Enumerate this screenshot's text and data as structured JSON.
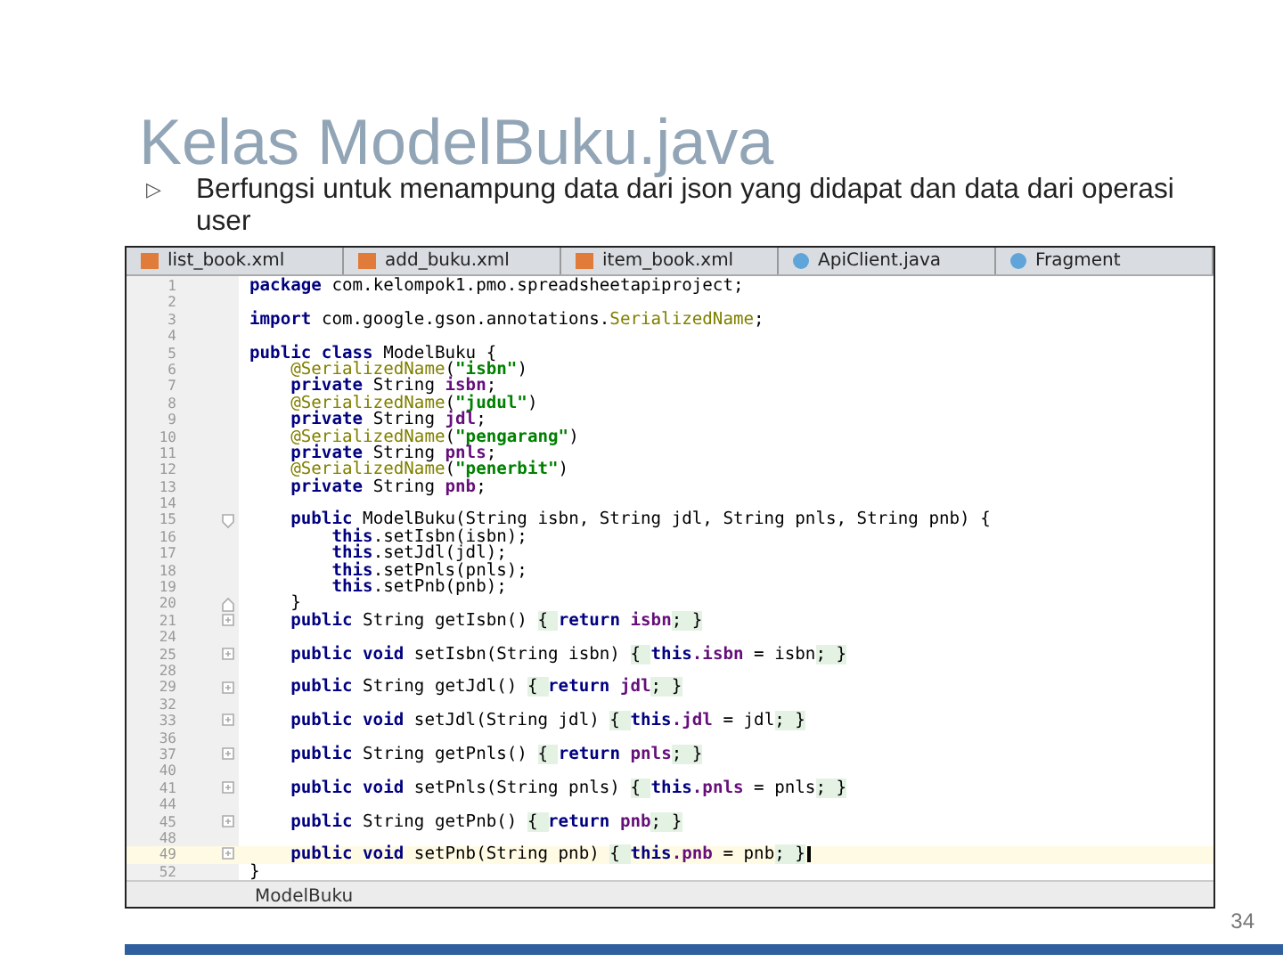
{
  "slide": {
    "title": "Kelas ModelBuku.java",
    "bullet": {
      "marker": "▷",
      "text": "Berfungsi untuk menampung data dari json yang didapat dan data dari operasi user"
    },
    "number": "34"
  },
  "editor": {
    "tabs": [
      {
        "label": "list_book.xml",
        "kind": "xml"
      },
      {
        "label": "add_buku.xml",
        "kind": "xml"
      },
      {
        "label": "item_book.xml",
        "kind": "xml"
      },
      {
        "label": "ApiClient.java",
        "kind": "java"
      },
      {
        "label": "Fragment",
        "kind": "java"
      }
    ],
    "lines": [
      {
        "number": "1",
        "current": false,
        "kind": "code",
        "tokens": [
          {
            "kind": "kw",
            "text": "package "
          },
          {
            "kind": "plain",
            "text": "com.kelompok1.pmo.spreadsheetapiproject;"
          }
        ]
      },
      {
        "number": "2",
        "current": false,
        "kind": "code"
      },
      {
        "number": "3",
        "current": false,
        "kind": "code",
        "tokens": [
          {
            "kind": "kw",
            "text": "import "
          },
          {
            "kind": "plain",
            "text": "com.google.gson.annotations."
          },
          {
            "kind": "ann",
            "text": "SerializedName"
          },
          {
            "kind": "plain",
            "text": ";"
          }
        ]
      },
      {
        "number": "4",
        "current": false,
        "kind": "code"
      },
      {
        "number": "5",
        "current": false,
        "kind": "code",
        "tokens": [
          {
            "kind": "kw",
            "text": "public class "
          },
          {
            "kind": "plain",
            "text": "ModelBuku {"
          }
        ]
      },
      {
        "number": "6",
        "current": false,
        "kind": "code",
        "tokens": [
          {
            "kind": "ann",
            "text": "    @SerializedName"
          },
          {
            "kind": "plain",
            "text": "("
          },
          {
            "kind": "str",
            "text": "\"isbn\""
          },
          {
            "kind": "plain",
            "text": ")"
          }
        ]
      },
      {
        "number": "7",
        "current": false,
        "kind": "code",
        "tokens": [
          {
            "kind": "kw",
            "text": "    private "
          },
          {
            "kind": "plain",
            "text": "String "
          },
          {
            "kind": "field",
            "text": "isbn"
          },
          {
            "kind": "plain",
            "text": ";"
          }
        ]
      },
      {
        "number": "8",
        "current": false,
        "kind": "code",
        "tokens": [
          {
            "kind": "ann",
            "text": "    @SerializedName"
          },
          {
            "kind": "plain",
            "text": "("
          },
          {
            "kind": "str",
            "text": "\"judul\""
          },
          {
            "kind": "plain",
            "text": ")"
          }
        ]
      },
      {
        "number": "9",
        "current": false,
        "kind": "code",
        "tokens": [
          {
            "kind": "kw",
            "text": "    private "
          },
          {
            "kind": "plain",
            "text": "String "
          },
          {
            "kind": "field",
            "text": "jdl"
          },
          {
            "kind": "plain",
            "text": ";"
          }
        ]
      },
      {
        "number": "10",
        "current": false,
        "kind": "code",
        "tokens": [
          {
            "kind": "ann",
            "text": "    @SerializedName"
          },
          {
            "kind": "plain",
            "text": "("
          },
          {
            "kind": "str",
            "text": "\"pengarang\""
          },
          {
            "kind": "plain",
            "text": ")"
          }
        ]
      },
      {
        "number": "11",
        "current": false,
        "kind": "code",
        "tokens": [
          {
            "kind": "kw",
            "text": "    private "
          },
          {
            "kind": "plain",
            "text": "String "
          },
          {
            "kind": "field",
            "text": "pnls"
          },
          {
            "kind": "plain",
            "text": ";"
          }
        ]
      },
      {
        "number": "12",
        "current": false,
        "kind": "code",
        "tokens": [
          {
            "kind": "ann",
            "text": "    @SerializedName"
          },
          {
            "kind": "plain",
            "text": "("
          },
          {
            "kind": "str",
            "text": "\"penerbit\""
          },
          {
            "kind": "plain",
            "text": ")"
          }
        ]
      },
      {
        "number": "13",
        "current": false,
        "kind": "code",
        "tokens": [
          {
            "kind": "kw",
            "text": "    private "
          },
          {
            "kind": "plain",
            "text": "String "
          },
          {
            "kind": "field",
            "text": "pnb"
          },
          {
            "kind": "plain",
            "text": ";"
          }
        ]
      },
      {
        "number": "14",
        "current": false,
        "kind": "code"
      },
      {
        "number": "15",
        "current": false,
        "kind": "open",
        "tokens": [
          {
            "kind": "kw",
            "text": "    public "
          },
          {
            "kind": "plain",
            "text": "ModelBuku(String isbn, String jdl, String pnls, String pnb) {"
          }
        ]
      },
      {
        "number": "16",
        "current": false,
        "kind": "code",
        "tokens": [
          {
            "kind": "kw",
            "text": "        this"
          },
          {
            "kind": "plain",
            "text": ".setIsbn(isbn);"
          }
        ]
      },
      {
        "number": "17",
        "current": false,
        "kind": "code",
        "tokens": [
          {
            "kind": "kw",
            "text": "        this"
          },
          {
            "kind": "plain",
            "text": ".setJdl(jdl);"
          }
        ]
      },
      {
        "number": "18",
        "current": false,
        "kind": "code",
        "tokens": [
          {
            "kind": "kw",
            "text": "        this"
          },
          {
            "kind": "plain",
            "text": ".setPnls(pnls);"
          }
        ]
      },
      {
        "number": "19",
        "current": false,
        "kind": "code",
        "tokens": [
          {
            "kind": "kw",
            "text": "        this"
          },
          {
            "kind": "plain",
            "text": ".setPnb(pnb);"
          }
        ]
      },
      {
        "number": "20",
        "current": false,
        "kind": "close",
        "tokens": [
          {
            "kind": "plain",
            "text": "    }"
          }
        ]
      },
      {
        "number": "21",
        "current": false,
        "kind": "folded",
        "tokens": [
          {
            "kind": "kw",
            "text": "    public "
          },
          {
            "kind": "plain",
            "text": "String getIsbn() "
          },
          {
            "kind": "brace",
            "text": "{ "
          },
          {
            "kind": "kw",
            "text": "return "
          },
          {
            "kind": "field",
            "text": "isbn"
          },
          {
            "kind": "brace",
            "text": "; }"
          }
        ]
      },
      {
        "number": "24",
        "current": false,
        "kind": "code"
      },
      {
        "number": "25",
        "current": false,
        "kind": "folded",
        "tokens": [
          {
            "kind": "kw",
            "text": "    public void "
          },
          {
            "kind": "plain",
            "text": "setIsbn(String isbn) "
          },
          {
            "kind": "brace",
            "text": "{ "
          },
          {
            "kind": "kw",
            "text": "this"
          },
          {
            "kind": "field",
            "text": ".isbn"
          },
          {
            "kind": "plain",
            "text": " = isbn"
          },
          {
            "kind": "brace",
            "text": "; }"
          }
        ]
      },
      {
        "number": "28",
        "current": false,
        "kind": "code"
      },
      {
        "number": "29",
        "current": false,
        "kind": "folded",
        "tokens": [
          {
            "kind": "kw",
            "text": "    public "
          },
          {
            "kind": "plain",
            "text": "String getJdl() "
          },
          {
            "kind": "brace",
            "text": "{ "
          },
          {
            "kind": "kw",
            "text": "return "
          },
          {
            "kind": "field",
            "text": "jdl"
          },
          {
            "kind": "brace",
            "text": "; }"
          }
        ]
      },
      {
        "number": "32",
        "current": false,
        "kind": "code"
      },
      {
        "number": "33",
        "current": false,
        "kind": "folded",
        "tokens": [
          {
            "kind": "kw",
            "text": "    public void "
          },
          {
            "kind": "plain",
            "text": "setJdl(String jdl) "
          },
          {
            "kind": "brace",
            "text": "{ "
          },
          {
            "kind": "kw",
            "text": "this"
          },
          {
            "kind": "field",
            "text": ".jdl"
          },
          {
            "kind": "plain",
            "text": " = jdl"
          },
          {
            "kind": "brace",
            "text": "; }"
          }
        ]
      },
      {
        "number": "36",
        "current": false,
        "kind": "code"
      },
      {
        "number": "37",
        "current": false,
        "kind": "folded",
        "tokens": [
          {
            "kind": "kw",
            "text": "    public "
          },
          {
            "kind": "plain",
            "text": "String getPnls() "
          },
          {
            "kind": "brace",
            "text": "{ "
          },
          {
            "kind": "kw",
            "text": "return "
          },
          {
            "kind": "field",
            "text": "pnls"
          },
          {
            "kind": "brace",
            "text": "; }"
          }
        ]
      },
      {
        "number": "40",
        "current": false,
        "kind": "code"
      },
      {
        "number": "41",
        "current": false,
        "kind": "folded",
        "tokens": [
          {
            "kind": "kw",
            "text": "    public void "
          },
          {
            "kind": "plain",
            "text": "setPnls(String pnls) "
          },
          {
            "kind": "brace",
            "text": "{ "
          },
          {
            "kind": "kw",
            "text": "this"
          },
          {
            "kind": "field",
            "text": ".pnls"
          },
          {
            "kind": "plain",
            "text": " = pnls"
          },
          {
            "kind": "brace",
            "text": "; }"
          }
        ]
      },
      {
        "number": "44",
        "current": false,
        "kind": "code"
      },
      {
        "number": "45",
        "current": false,
        "kind": "folded",
        "tokens": [
          {
            "kind": "kw",
            "text": "    public "
          },
          {
            "kind": "plain",
            "text": "String getPnb() "
          },
          {
            "kind": "brace",
            "text": "{ "
          },
          {
            "kind": "kw",
            "text": "return "
          },
          {
            "kind": "field",
            "text": "pnb"
          },
          {
            "kind": "brace",
            "text": "; }"
          }
        ]
      },
      {
        "number": "48",
        "current": false,
        "kind": "code"
      },
      {
        "number": "49",
        "current": true,
        "kind": "folded",
        "tokens": [
          {
            "kind": "kw",
            "text": "    public void "
          },
          {
            "kind": "plain",
            "text": "setPnb(String pnb) "
          },
          {
            "kind": "brace",
            "text": "{ "
          },
          {
            "kind": "kw",
            "text": "this"
          },
          {
            "kind": "field",
            "text": ".pnb"
          },
          {
            "kind": "plain",
            "text": " = pnb"
          },
          {
            "kind": "brace",
            "text": "; }"
          }
        ]
      },
      {
        "number": "52",
        "current": false,
        "kind": "code",
        "tokens": [
          {
            "kind": "plain",
            "text": "}"
          }
        ]
      }
    ],
    "status": "ModelBuku"
  }
}
